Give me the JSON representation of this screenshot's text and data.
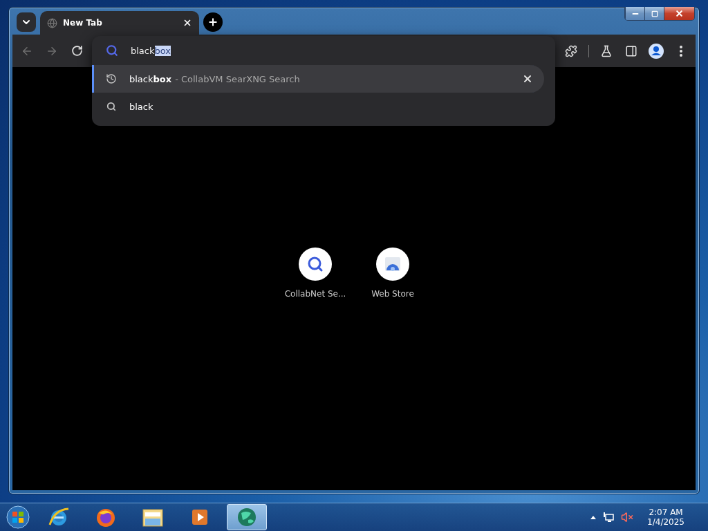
{
  "tabs": [
    {
      "title": "New Tab",
      "selected": true
    }
  ],
  "omnibox": {
    "typed": "black",
    "autocomplete": "box"
  },
  "suggestions": [
    {
      "kind": "history",
      "text": "black**box**",
      "description": "- CollabVM SearXNG Search",
      "selected": true
    },
    {
      "kind": "search",
      "text": "black",
      "selected": false
    }
  ],
  "shortcuts": [
    {
      "kind": "search",
      "label": "CollabNet Se..."
    },
    {
      "kind": "store",
      "label": "Web Store"
    }
  ],
  "taskbar": {
    "apps": [
      {
        "kind": "ie",
        "active": false
      },
      {
        "kind": "firefox",
        "active": false
      },
      {
        "kind": "explorer",
        "active": false
      },
      {
        "kind": "media",
        "active": false
      },
      {
        "kind": "collab",
        "active": true
      }
    ],
    "volume_muted": true,
    "time": "2:07 AM",
    "date": "1/4/2025"
  }
}
